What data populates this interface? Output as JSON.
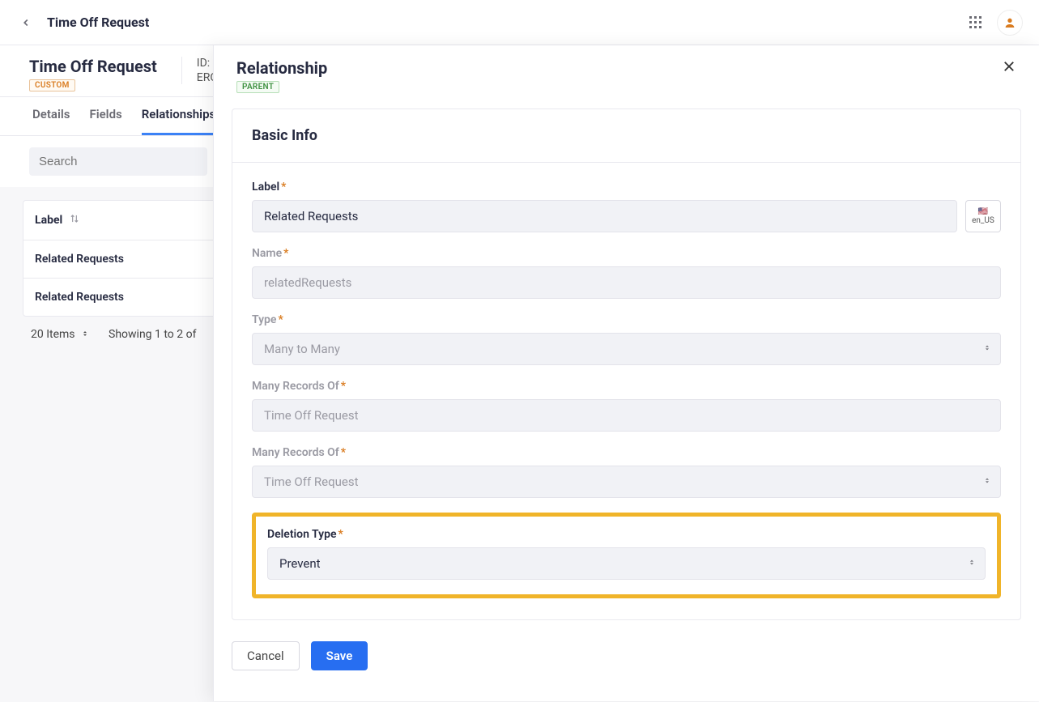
{
  "topbar": {
    "title": "Time Off Request"
  },
  "page": {
    "title": "Time Off Request",
    "badge": "CUSTOM",
    "id_label": "ID:",
    "id_value": "ERC"
  },
  "tabs": {
    "details": "Details",
    "fields": "Fields",
    "relationships": "Relationships"
  },
  "search": {
    "placeholder": "Search"
  },
  "list": {
    "header": "Label",
    "rows": [
      "Related Requests",
      "Related Requests"
    ],
    "items_text": "20 Items",
    "showing_text": "Showing 1 to 2 of"
  },
  "panel": {
    "title": "Relationship",
    "badge": "PARENT",
    "section_title": "Basic Info",
    "fields": {
      "label_label": "Label",
      "label_value": "Related Requests",
      "locale": "en_US",
      "name_label": "Name",
      "name_value": "relatedRequests",
      "type_label": "Type",
      "type_value": "Many to Many",
      "many1_label": "Many Records Of",
      "many1_value": "Time Off Request",
      "many2_label": "Many Records Of",
      "many2_value": "Time Off Request",
      "deletion_label": "Deletion Type",
      "deletion_value": "Prevent"
    },
    "buttons": {
      "cancel": "Cancel",
      "save": "Save"
    }
  }
}
